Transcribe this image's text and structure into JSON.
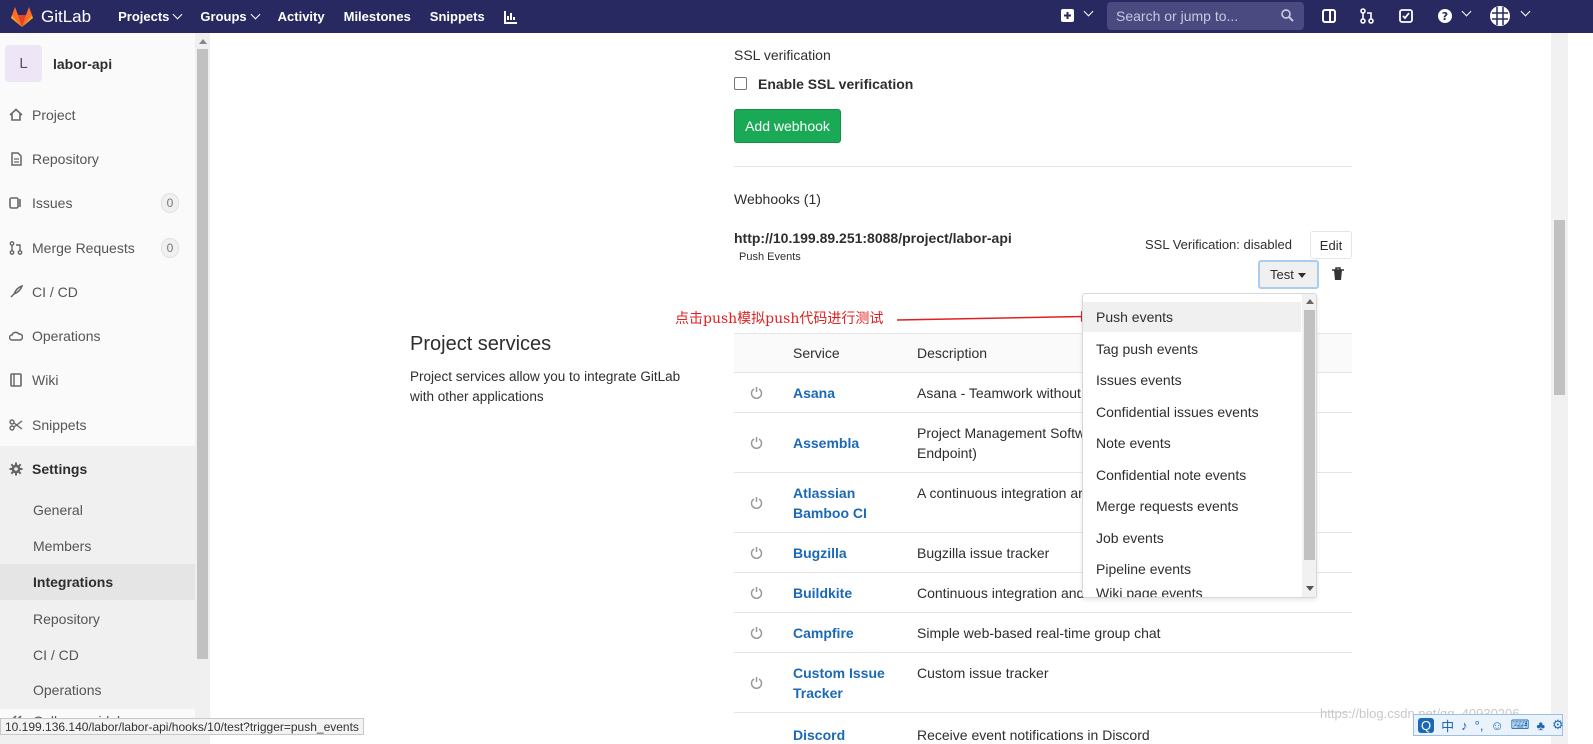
{
  "app": {
    "name": "GitLab"
  },
  "nav": {
    "links": [
      "Projects",
      "Groups",
      "Activity",
      "Milestones",
      "Snippets"
    ],
    "search_placeholder": "Search or jump to..."
  },
  "sidebar": {
    "avatar_letter": "L",
    "project_name": "labor-api",
    "items": [
      {
        "label": "Project",
        "icon": "home-icon"
      },
      {
        "label": "Repository",
        "icon": "doc-icon"
      },
      {
        "label": "Issues",
        "icon": "issues-icon",
        "badge": "0"
      },
      {
        "label": "Merge Requests",
        "icon": "merge-icon",
        "badge": "0"
      },
      {
        "label": "CI / CD",
        "icon": "rocket-icon"
      },
      {
        "label": "Operations",
        "icon": "cloud-icon"
      },
      {
        "label": "Wiki",
        "icon": "book-icon"
      },
      {
        "label": "Snippets",
        "icon": "scissors-icon"
      }
    ],
    "settings_label": "Settings",
    "settings_items": [
      "General",
      "Members",
      "Integrations",
      "Repository",
      "CI / CD",
      "Operations"
    ],
    "collapse_label": "Collapse sidebar"
  },
  "main": {
    "ssl_heading": "SSL verification",
    "ssl_checkbox_label": "Enable SSL verification",
    "add_webhook_label": "Add webhook",
    "webhooks_heading": "Webhooks (1)",
    "webhook_url": "http://10.199.89.251:8088/project/labor-api",
    "webhook_event_tag": "Push Events",
    "ssl_status": "SSL Verification: disabled",
    "edit_label": "Edit",
    "test_label": "Test",
    "annotation": "点击push模拟push代码进行测试",
    "services_title": "Project services",
    "services_desc_line1": "Project services allow you to integrate GitLab",
    "services_desc_line2": "with other applications",
    "table_headers": {
      "service": "Service",
      "description": "Description"
    },
    "services": [
      {
        "name1": "Asana",
        "name2": "",
        "desc1": "Asana - Teamwork without",
        "desc2": ""
      },
      {
        "name1": "Assembla",
        "name2": "",
        "desc1": "Project Management Softw",
        "desc2": "Endpoint)"
      },
      {
        "name1": "Atlassian",
        "name2": "Bamboo CI",
        "desc1": "A continuous integration ar",
        "desc2": ""
      },
      {
        "name1": "Bugzilla",
        "name2": "",
        "desc1": "Bugzilla issue tracker",
        "desc2": ""
      },
      {
        "name1": "Buildkite",
        "name2": "",
        "desc1": "Continuous integration and",
        "desc2": ""
      },
      {
        "name1": "Campfire",
        "name2": "",
        "desc1": "Simple web-based real-time group chat",
        "desc2": ""
      },
      {
        "name1": "Custom Issue",
        "name2": "Tracker",
        "desc1": "Custom issue tracker",
        "desc2": ""
      },
      {
        "name1": "Discord",
        "name2": "",
        "desc1": "Receive event notifications in Discord",
        "desc2": ""
      }
    ]
  },
  "dropdown": {
    "items": [
      "Push events",
      "Tag push events",
      "Issues events",
      "Confidential issues events",
      "Note events",
      "Confidential note events",
      "Merge requests events",
      "Job events",
      "Pipeline events",
      "Wiki page events"
    ]
  },
  "status_url": "10.199.136.140/labor/labor-api/hooks/10/test?trigger=push_events",
  "watermark": "https://blog.csdn.net/qq_40930206",
  "ime": [
    "中",
    "♪",
    "°,",
    "☺",
    "⌨",
    "♣",
    "⚙"
  ]
}
